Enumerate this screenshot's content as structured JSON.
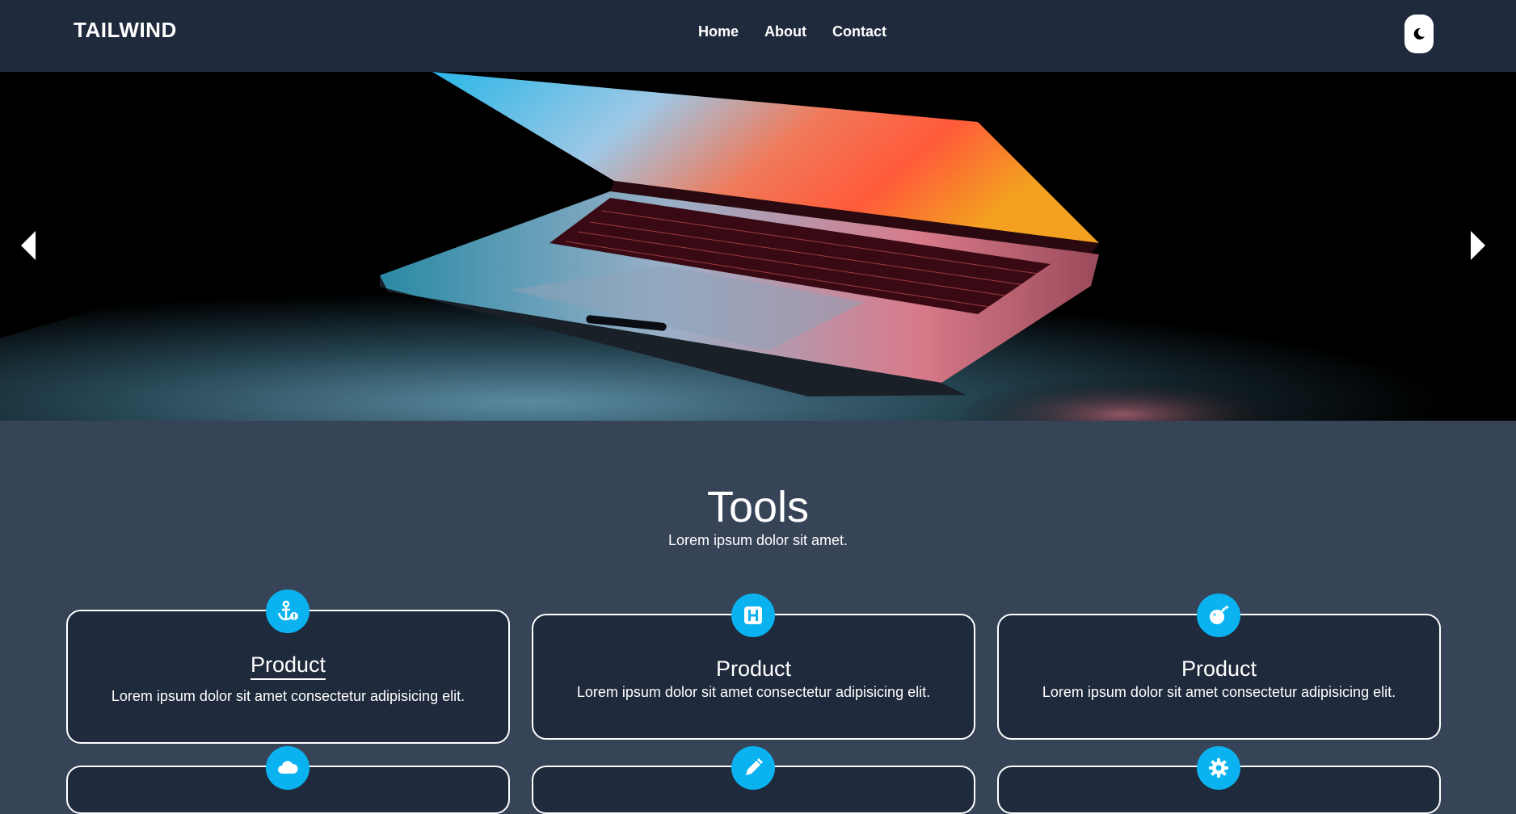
{
  "brand": "TAILWIND",
  "nav": {
    "home": "Home",
    "about": "About",
    "contact": "Contact"
  },
  "theme_toggle": {
    "icon": "moon-icon"
  },
  "hero": {
    "image": "laptop-photo",
    "prev_icon": "chevron-left-icon",
    "next_icon": "chevron-right-icon"
  },
  "section": {
    "title": "Tools",
    "subtitle": "Lorem ipsum dolor sit amet."
  },
  "cards": [
    {
      "title": "Product",
      "text": "Lorem ipsum dolor sit amet consectetur adipisicing elit.",
      "icon": "anchor-icon"
    },
    {
      "title": "Product",
      "text": "Lorem ipsum dolor sit amet consectetur adipisicing elit.",
      "icon": "h-square-icon"
    },
    {
      "title": "Product",
      "text": "Lorem ipsum dolor sit amet consectetur adipisicing elit.",
      "icon": "bomb-icon"
    }
  ],
  "next_row_icons": [
    "cloud-icon",
    "pencil-icon",
    "gear-icon"
  ],
  "colors": {
    "navbar": "#1f2a3c",
    "page": "#374357",
    "accent": "#0ab3f0",
    "card": "#1f2a3c"
  }
}
